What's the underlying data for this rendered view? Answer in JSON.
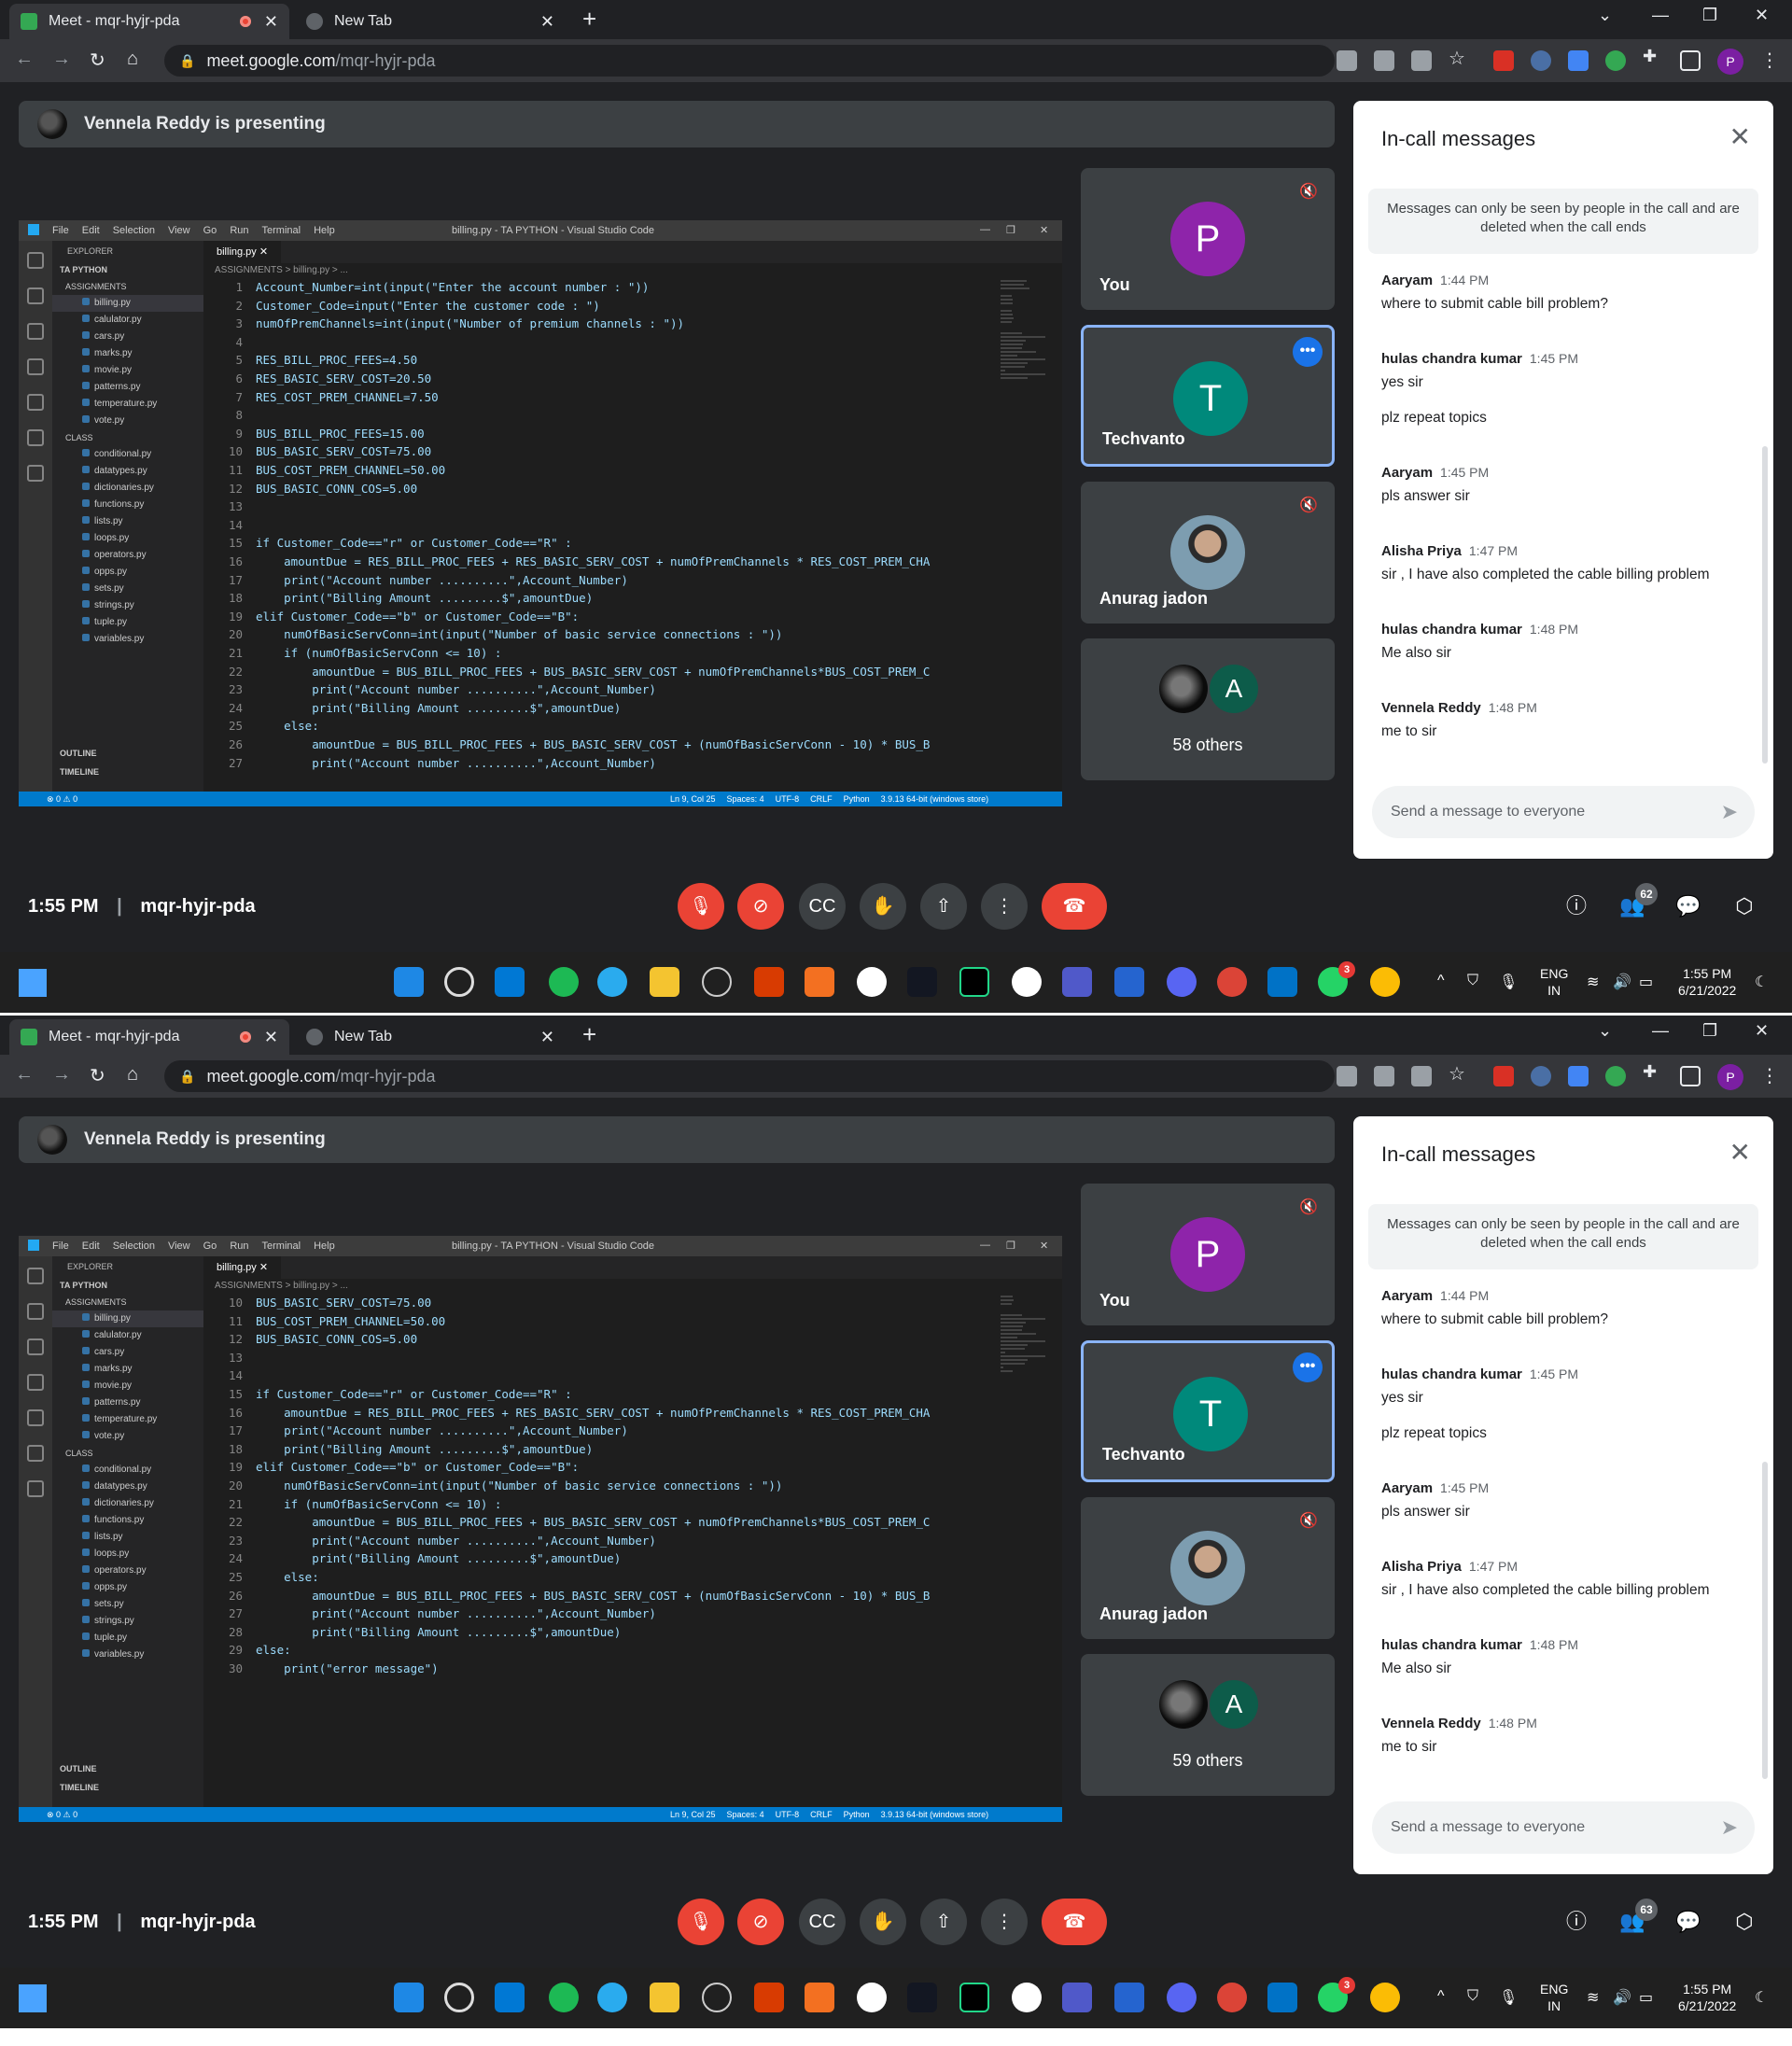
{
  "screens": [
    {
      "browser": {
        "tabs": [
          {
            "title": "Meet - mqr-hyjr-pda",
            "active": true,
            "recording": true
          },
          {
            "title": "New Tab",
            "active": false
          }
        ],
        "url_domain": "meet.google.com",
        "url_path": "/mqr-hyjr-pda",
        "profile_initial": "P"
      },
      "presenting_banner": "Vennela Reddy is presenting",
      "vscode": {
        "window_title": "billing.py - TA PYTHON - Visual Studio Code",
        "menu": [
          "File",
          "Edit",
          "Selection",
          "View",
          "Go",
          "Run",
          "Terminal",
          "Help"
        ],
        "explorer_header": "EXPLORER",
        "root_folder": "TA PYTHON",
        "folders": [
          {
            "name": "ASSIGNMENTS",
            "files": [
              "billing.py",
              "calulator.py",
              "cars.py",
              "marks.py",
              "movie.py",
              "patterns.py",
              "temperature.py",
              "vote.py"
            ]
          },
          {
            "name": "CLASS",
            "files": [
              "conditional.py",
              "datatypes.py",
              "dictionaries.py",
              "functions.py",
              "lists.py",
              "loops.py",
              "operators.py",
              "opps.py",
              "sets.py",
              "strings.py",
              "tuple.py",
              "variables.py"
            ]
          }
        ],
        "outline_label": "OUTLINE",
        "timeline_label": "TIMELINE",
        "active_tab": "billing.py",
        "breadcrumb": "ASSIGNMENTS > billing.py > ...",
        "code_lines": [
          {
            "n": "1",
            "code": "Account_Number=int(input(\"Enter the account number : \"))"
          },
          {
            "n": "2",
            "code": "Customer_Code=input(\"Enter the customer code : \")"
          },
          {
            "n": "3",
            "code": "numOfPremChannels=int(input(\"Number of premium channels : \"))"
          },
          {
            "n": "4",
            "code": ""
          },
          {
            "n": "5",
            "code": "RES_BILL_PROC_FEES=4.50"
          },
          {
            "n": "6",
            "code": "RES_BASIC_SERV_COST=20.50"
          },
          {
            "n": "7",
            "code": "RES_COST_PREM_CHANNEL=7.50"
          },
          {
            "n": "8",
            "code": ""
          },
          {
            "n": "9",
            "code": "BUS_BILL_PROC_FEES=15.00"
          },
          {
            "n": "10",
            "code": "BUS_BASIC_SERV_COST=75.00"
          },
          {
            "n": "11",
            "code": "BUS_COST_PREM_CHANNEL=50.00"
          },
          {
            "n": "12",
            "code": "BUS_BASIC_CONN_COS=5.00"
          },
          {
            "n": "13",
            "code": ""
          },
          {
            "n": "14",
            "code": ""
          },
          {
            "n": "15",
            "code": "if Customer_Code==\"r\" or Customer_Code==\"R\" :"
          },
          {
            "n": "16",
            "code": "    amountDue = RES_BILL_PROC_FEES + RES_BASIC_SERV_COST + numOfPremChannels * RES_COST_PREM_CHA"
          },
          {
            "n": "17",
            "code": "    print(\"Account number ..........\",Account_Number)"
          },
          {
            "n": "18",
            "code": "    print(\"Billing Amount .........$\",amountDue)"
          },
          {
            "n": "19",
            "code": "elif Customer_Code==\"b\" or Customer_Code==\"B\":"
          },
          {
            "n": "20",
            "code": "    numOfBasicServConn=int(input(\"Number of basic service connections : \"))"
          },
          {
            "n": "21",
            "code": "    if (numOfBasicServConn <= 10) :"
          },
          {
            "n": "22",
            "code": "        amountDue = BUS_BILL_PROC_FEES + BUS_BASIC_SERV_COST + numOfPremChannels*BUS_COST_PREM_C"
          },
          {
            "n": "23",
            "code": "        print(\"Account number ..........\",Account_Number)"
          },
          {
            "n": "24",
            "code": "        print(\"Billing Amount .........$\",amountDue)"
          },
          {
            "n": "25",
            "code": "    else:"
          },
          {
            "n": "26",
            "code": "        amountDue = BUS_BILL_PROC_FEES + BUS_BASIC_SERV_COST + (numOfBasicServConn - 10) * BUS_B"
          },
          {
            "n": "27",
            "code": "        print(\"Account number ..........\",Account_Number)"
          }
        ],
        "status_left": "⊗ 0 ⚠ 0",
        "status_right": [
          "Ln 9, Col 25",
          "Spaces: 4",
          "UTF-8",
          "CRLF",
          "Python",
          "3.9.13 64-bit (windows store)"
        ]
      },
      "participants": [
        {
          "name": "You",
          "initial": "P",
          "color": "#8e24aa",
          "muted": true
        },
        {
          "name": "Techvanto",
          "initial": "T",
          "color": "#00897b",
          "active": true
        },
        {
          "name": "Anurag jadon",
          "photo": true,
          "muted": true
        },
        {
          "name": "58 others",
          "others": true,
          "initial": "A"
        }
      ],
      "chat": {
        "title": "In-call messages",
        "notice": "Messages can only be seen by people in the call and are deleted when the call ends",
        "messages": [
          {
            "sender": "Aaryam",
            "time": "1:44 PM",
            "texts": [
              "where to submit cable bill problem?"
            ]
          },
          {
            "sender": "hulas chandra kumar",
            "time": "1:45 PM",
            "texts": [
              "yes sir",
              "plz repeat topics"
            ]
          },
          {
            "sender": "Aaryam",
            "time": "1:45 PM",
            "texts": [
              "pls answer sir"
            ]
          },
          {
            "sender": "Alisha Priya",
            "time": "1:47 PM",
            "texts": [
              "sir , I have also completed the cable billing problem"
            ]
          },
          {
            "sender": "hulas chandra kumar",
            "time": "1:48 PM",
            "texts": [
              "Me also sir"
            ]
          },
          {
            "sender": "Vennela Reddy",
            "time": "1:48 PM",
            "texts": [
              "me to sir"
            ]
          }
        ],
        "placeholder": "Send a message to everyone"
      },
      "meeting": {
        "time": "1:55 PM",
        "code": "mqr-hyjr-pda",
        "people_count": "62"
      },
      "taskbar": {
        "lang": "ENG",
        "region": "IN",
        "time": "1:55 PM",
        "date": "6/21/2022",
        "whatsapp_badge": "3"
      }
    },
    {
      "browser": {
        "tabs": [
          {
            "title": "Meet - mqr-hyjr-pda",
            "active": true,
            "recording": true
          },
          {
            "title": "New Tab",
            "active": false
          }
        ],
        "url_domain": "meet.google.com",
        "url_path": "/mqr-hyjr-pda",
        "profile_initial": "P"
      },
      "presenting_banner": "Vennela Reddy is presenting",
      "vscode": {
        "window_title": "billing.py - TA PYTHON - Visual Studio Code",
        "menu": [
          "File",
          "Edit",
          "Selection",
          "View",
          "Go",
          "Run",
          "Terminal",
          "Help"
        ],
        "explorer_header": "EXPLORER",
        "root_folder": "TA PYTHON",
        "folders": [
          {
            "name": "ASSIGNMENTS",
            "files": [
              "billing.py",
              "calulator.py",
              "cars.py",
              "marks.py",
              "movie.py",
              "patterns.py",
              "temperature.py",
              "vote.py"
            ]
          },
          {
            "name": "CLASS",
            "files": [
              "conditional.py",
              "datatypes.py",
              "dictionaries.py",
              "functions.py",
              "lists.py",
              "loops.py",
              "operators.py",
              "opps.py",
              "sets.py",
              "strings.py",
              "tuple.py",
              "variables.py"
            ]
          }
        ],
        "outline_label": "OUTLINE",
        "timeline_label": "TIMELINE",
        "active_tab": "billing.py",
        "breadcrumb": "ASSIGNMENTS > billing.py > ...",
        "code_lines": [
          {
            "n": "10",
            "code": "BUS_BASIC_SERV_COST=75.00"
          },
          {
            "n": "11",
            "code": "BUS_COST_PREM_CHANNEL=50.00"
          },
          {
            "n": "12",
            "code": "BUS_BASIC_CONN_COS=5.00"
          },
          {
            "n": "13",
            "code": ""
          },
          {
            "n": "14",
            "code": ""
          },
          {
            "n": "15",
            "code": "if Customer_Code==\"r\" or Customer_Code==\"R\" :"
          },
          {
            "n": "16",
            "code": "    amountDue = RES_BILL_PROC_FEES + RES_BASIC_SERV_COST + numOfPremChannels * RES_COST_PREM_CHA"
          },
          {
            "n": "17",
            "code": "    print(\"Account number ..........\",Account_Number)"
          },
          {
            "n": "18",
            "code": "    print(\"Billing Amount .........$\",amountDue)"
          },
          {
            "n": "19",
            "code": "elif Customer_Code==\"b\" or Customer_Code==\"B\":"
          },
          {
            "n": "20",
            "code": "    numOfBasicServConn=int(input(\"Number of basic service connections : \"))"
          },
          {
            "n": "21",
            "code": "    if (numOfBasicServConn <= 10) :"
          },
          {
            "n": "22",
            "code": "        amountDue = BUS_BILL_PROC_FEES + BUS_BASIC_SERV_COST + numOfPremChannels*BUS_COST_PREM_C"
          },
          {
            "n": "23",
            "code": "        print(\"Account number ..........\",Account_Number)"
          },
          {
            "n": "24",
            "code": "        print(\"Billing Amount .........$\",amountDue)"
          },
          {
            "n": "25",
            "code": "    else:"
          },
          {
            "n": "26",
            "code": "        amountDue = BUS_BILL_PROC_FEES + BUS_BASIC_SERV_COST + (numOfBasicServConn - 10) * BUS_B"
          },
          {
            "n": "27",
            "code": "        print(\"Account number ..........\",Account_Number)"
          },
          {
            "n": "28",
            "code": "        print(\"Billing Amount .........$\",amountDue)"
          },
          {
            "n": "29",
            "code": "else:"
          },
          {
            "n": "30",
            "code": "    print(\"error message\")"
          }
        ],
        "status_left": "⊗ 0 ⚠ 0",
        "status_right": [
          "Ln 9, Col 25",
          "Spaces: 4",
          "UTF-8",
          "CRLF",
          "Python",
          "3.9.13 64-bit (windows store)"
        ]
      },
      "participants": [
        {
          "name": "You",
          "initial": "P",
          "color": "#8e24aa",
          "muted": true
        },
        {
          "name": "Techvanto",
          "initial": "T",
          "color": "#00897b",
          "active": true
        },
        {
          "name": "Anurag jadon",
          "photo": true,
          "muted": true
        },
        {
          "name": "59 others",
          "others": true,
          "initial": "A"
        }
      ],
      "chat": {
        "title": "In-call messages",
        "notice": "Messages can only be seen by people in the call and are deleted when the call ends",
        "messages": [
          {
            "sender": "Aaryam",
            "time": "1:44 PM",
            "texts": [
              "where to submit cable bill problem?"
            ]
          },
          {
            "sender": "hulas chandra kumar",
            "time": "1:45 PM",
            "texts": [
              "yes sir",
              "plz repeat topics"
            ]
          },
          {
            "sender": "Aaryam",
            "time": "1:45 PM",
            "texts": [
              "pls answer sir"
            ]
          },
          {
            "sender": "Alisha Priya",
            "time": "1:47 PM",
            "texts": [
              "sir , I have also completed the cable billing problem"
            ]
          },
          {
            "sender": "hulas chandra kumar",
            "time": "1:48 PM",
            "texts": [
              "Me also sir"
            ]
          },
          {
            "sender": "Vennela Reddy",
            "time": "1:48 PM",
            "texts": [
              "me to sir"
            ]
          }
        ],
        "placeholder": "Send a message to everyone"
      },
      "meeting": {
        "time": "1:55 PM",
        "code": "mqr-hyjr-pda",
        "people_count": "63"
      },
      "taskbar": {
        "lang": "ENG",
        "region": "IN",
        "time": "1:55 PM",
        "date": "6/21/2022",
        "whatsapp_badge": "3"
      }
    }
  ],
  "icons": {
    "mic_off": "mic-off-icon",
    "camera_off": "camera-off-icon",
    "captions": "captions-icon",
    "raise_hand": "raise-hand-icon",
    "present": "present-icon",
    "more": "more-options-icon",
    "end_call": "end-call-icon",
    "info": "info-icon",
    "people": "people-icon",
    "chat": "chat-icon",
    "activities": "activities-icon"
  },
  "colors": {
    "meet_bg": "#202124",
    "end_call": "#ea4335",
    "active_tile_border": "#8ab4f8",
    "vscode_status": "#007acc"
  }
}
